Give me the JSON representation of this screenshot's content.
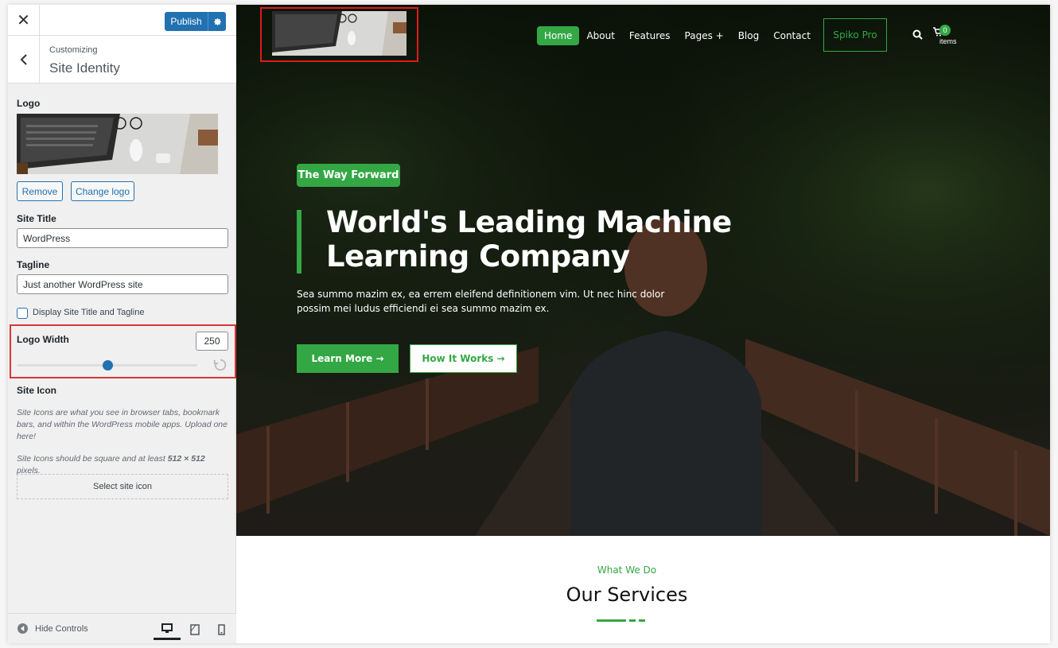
{
  "sidebar": {
    "publish_label": "Publish",
    "breadcrumb": "Customizing",
    "section_title": "Site Identity",
    "logo_label": "Logo",
    "remove_label": "Remove",
    "change_logo_label": "Change logo",
    "site_title_label": "Site Title",
    "site_title_value": "WordPress",
    "tagline_label": "Tagline",
    "tagline_value": "Just another WordPress site",
    "display_checkbox_label": "Display Site Title and Tagline",
    "display_checked": false,
    "logo_width_label": "Logo Width",
    "logo_width_value": "250",
    "logo_width_fraction": 0.5,
    "site_icon_label": "Site Icon",
    "site_icon_desc1": "Site Icons are what you see in browser tabs, bookmark bars, and within the WordPress mobile apps. Upload one here!",
    "site_icon_desc2_a": "Site Icons should be square and at least ",
    "site_icon_desc2_b": "512 × 512",
    "site_icon_desc2_c": " pixels.",
    "select_icon_label": "Select site icon",
    "hide_controls_label": "Hide Controls"
  },
  "preview": {
    "nav": [
      "Home",
      "About",
      "Features",
      "Pages +",
      "Blog",
      "Contact"
    ],
    "active_nav": "Home",
    "spiko_label": "Spiko Pro",
    "cart_count": "0",
    "cart_label": "items",
    "tagline_badge": "The Way Forward",
    "headline_line1": "World's Leading Machine",
    "headline_line2": "Learning Company",
    "paragraph": "Sea summo mazim ex, ea errem eleifend definitionem vim. Ut nec hinc dolor possim mei ludus efficiendi ei sea summo mazim ex.",
    "learn_more": "Learn More →",
    "how_it_works": "How It Works →",
    "what_we_do": "What We Do",
    "our_services": "Our Services"
  },
  "colors": {
    "accent_green": "#34a745",
    "wp_blue": "#2271b1",
    "highlight_red": "#d63638"
  },
  "icons": [
    "close-icon",
    "gear-icon",
    "chevron-left-icon",
    "reset-icon",
    "hide-controls-icon",
    "desktop-icon",
    "tablet-icon",
    "mobile-icon",
    "search-icon",
    "cart-icon"
  ]
}
